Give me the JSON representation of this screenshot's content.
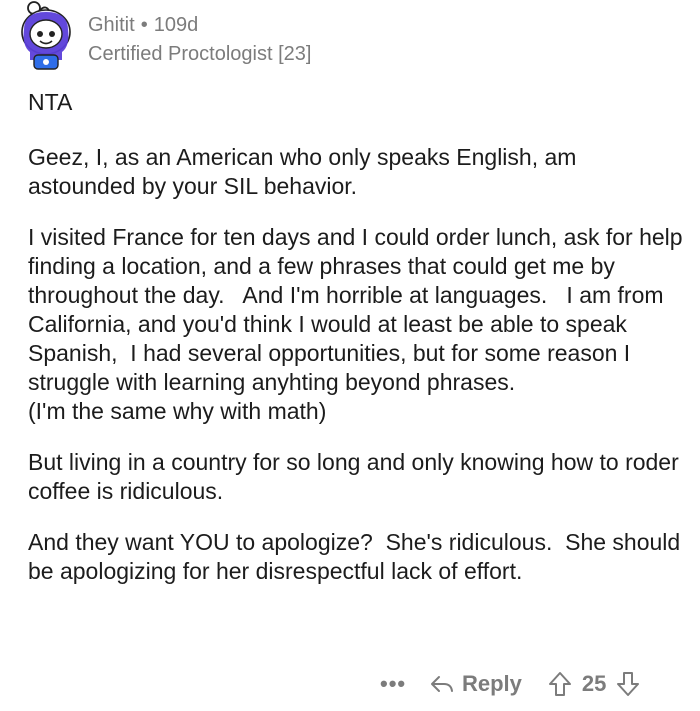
{
  "comment_header": {
    "username": "Ghitit",
    "separator": "•",
    "age": "109d",
    "flair": "Certified Proctologist [23]"
  },
  "comment_body": [
    "NTA",
    "Geez, I, as an American who only speaks English, am astounded by your SIL behavior.",
    "I visited France for ten days and I could order lunch, ask for help finding a location, and a few phrases that could get me by throughout the day.   And I'm horrible at languages.   I am from California, and you'd think I would at least be able to speak Spanish,  I had several opportunities, but for some reason I struggle with learning anyhting beyond phrases.\n(I'm the same why with math)",
    "But living in a country for so long and only knowing how to roder coffee is ridiculous.",
    "And they want YOU to apologize?  She's ridiculous.  She should be apologizing for her disrespectful lack of effort."
  ],
  "actions": {
    "more_label": "•••",
    "reply_label": "Reply",
    "score": "25"
  },
  "icons": {
    "avatar": "snoo-avatar-icon",
    "reply": "reply-arrow-icon",
    "upvote": "upvote-arrow-icon",
    "downvote": "downvote-arrow-icon"
  },
  "colors": {
    "meta_text": "#7c7c7c",
    "body_text": "#1c1c1c",
    "avatar_purple": "#5b3fd9",
    "avatar_blue": "#2f6ee8"
  }
}
